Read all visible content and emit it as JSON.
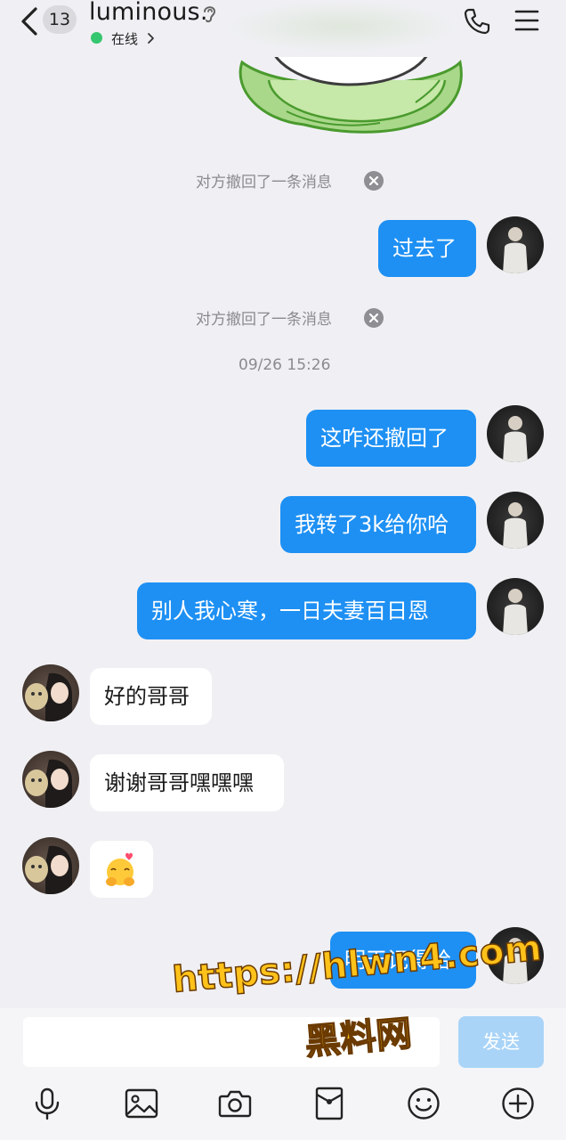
{
  "header": {
    "unread_count": "13",
    "contact_name": "luminous.",
    "status": "在线"
  },
  "messages": [
    {
      "type": "system",
      "text": "对方撤回了一条消息"
    },
    {
      "type": "outgoing",
      "text": "过去了"
    },
    {
      "type": "system",
      "text": "对方撤回了一条消息"
    },
    {
      "type": "timestamp",
      "text": "09/26 15:26"
    },
    {
      "type": "outgoing",
      "text": "这咋还撤回了"
    },
    {
      "type": "outgoing",
      "text": "我转了3k给你哈"
    },
    {
      "type": "outgoing",
      "text": "别人我心寒，一日夫妻百日恩"
    },
    {
      "type": "incoming",
      "text": "好的哥哥"
    },
    {
      "type": "incoming",
      "text": "谢谢哥哥嘿嘿嘿"
    },
    {
      "type": "incoming",
      "text": "",
      "emoji": "hugging-face"
    },
    {
      "type": "outgoing",
      "text": "明天记得哈"
    }
  ],
  "input": {
    "value": "",
    "send_label": "发送"
  },
  "toolbar": [
    "microphone-icon",
    "image-icon",
    "camera-icon",
    "red-packet-icon",
    "emoji-icon",
    "plus-icon"
  ],
  "watermark": {
    "url": "https://hlwn4.com",
    "name": "黑料网"
  },
  "colors": {
    "outgoing_bubble": "#1e90f3",
    "send_button": "#a9d4f8",
    "status_dot": "#35c76f",
    "background": "#f0f0f4"
  }
}
